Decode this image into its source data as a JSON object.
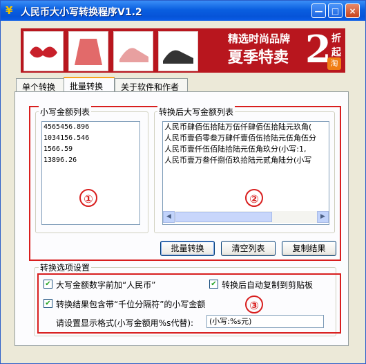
{
  "window": {
    "title": "人民币大小写转换程序V1.2",
    "icon": "yuan-icon",
    "buttons": [
      "—",
      "□",
      "×"
    ]
  },
  "banner": {
    "line1": "精选时尚品牌",
    "line2": "夏季特卖",
    "number": "2",
    "suffix": "折起",
    "badge": "淘"
  },
  "tabs": [
    "单个转换",
    "批量转换",
    "关于软件和作者"
  ],
  "active_tab": "批量转换",
  "lowercase_list": {
    "label": "小写金额列表",
    "items": [
      "4565456.896",
      "1034156.546",
      "1566.59",
      "13896.26"
    ]
  },
  "uppercase_list": {
    "label": "转换后大写金额列表",
    "items": [
      "人民币肆佰伍拾陆万伍仟肆佰伍拾陆元玖角(",
      "人民币壹佰零叁万肆仟壹佰伍拾陆元伍角伍分",
      "人民币壹仟伍佰陆拾陆元伍角玖分(小写:1,",
      "人民币壹万叁仟捌佰玖拾陆元贰角陆分(小写"
    ]
  },
  "annotations": [
    "①",
    "②",
    "③"
  ],
  "buttons": {
    "batch": "批量转换",
    "clear": "清空列表",
    "copy": "复制结果"
  },
  "options": {
    "label": "转换选项设置",
    "prefix": "大写金额数字前加“人民币”",
    "auto_copy": "转换后自动复制到剪贴板",
    "thousands": "转换结果包含带“千位分隔符”的小写金额",
    "format_label": "请设置显示格式(小写金额用%s代替):",
    "format_value": "(小写:%s元)"
  }
}
